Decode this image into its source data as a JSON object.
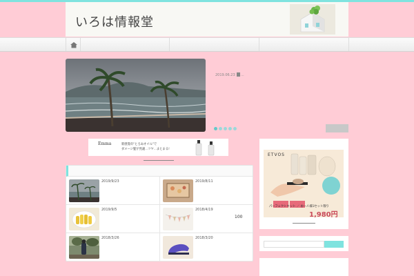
{
  "site": {
    "title": "いろは情報堂"
  },
  "nav": {
    "home_icon": "home-icon"
  },
  "slider": {
    "date": "2019.06.23",
    "category": "...",
    "slide_count": 5,
    "active_index": 0
  },
  "banner": {
    "brand": "Emma",
    "line1": "新感覚の\"とろみオイル\"で",
    "line2": "ダメージ髪が見違...ツヤ...まとまる!"
  },
  "posts": [
    {
      "date": "2019/9/23",
      "count": ""
    },
    {
      "date": "2019/8/11",
      "count": ""
    },
    {
      "date": "2019/9/5",
      "count": ""
    },
    {
      "date": "2018/4/19",
      "count": "100"
    },
    {
      "date": "2018/3/26",
      "count": ""
    },
    {
      "date": "2018/3/20",
      "count": ""
    }
  ],
  "ad": {
    "brand": "ETVOS",
    "caption": "パーフェクトキット ／ お一人様1セット限り",
    "price": "1,980円"
  },
  "search": {
    "placeholder": ""
  },
  "colors": {
    "accent": "#7fe3df",
    "background": "#ffccd6"
  }
}
